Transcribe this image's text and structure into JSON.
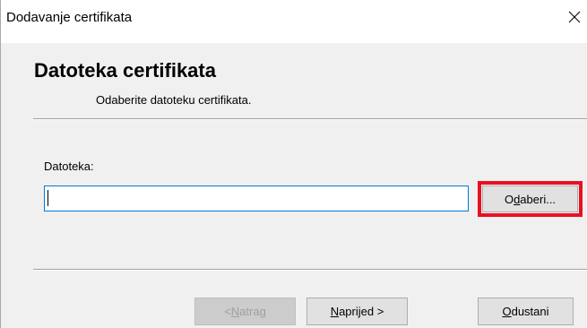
{
  "window": {
    "title": "Dodavanje certifikata"
  },
  "header": {
    "title": "Datoteka certifikata",
    "subtitle": "Odaberite datoteku certifikata."
  },
  "file_field": {
    "label": "Datoteka:",
    "value": "",
    "placeholder": ""
  },
  "buttons": {
    "browse": {
      "pre": "O",
      "accel": "d",
      "post": "aberi..."
    },
    "back": {
      "pre": "< ",
      "accel": "N",
      "post": "atrag",
      "enabled": false
    },
    "next": {
      "pre": "",
      "accel": "N",
      "post": "aprijed >"
    },
    "cancel": {
      "pre": "",
      "accel": "O",
      "post": "dustani"
    }
  },
  "highlight_color": "#e81123",
  "focus_color": "#0078d7"
}
